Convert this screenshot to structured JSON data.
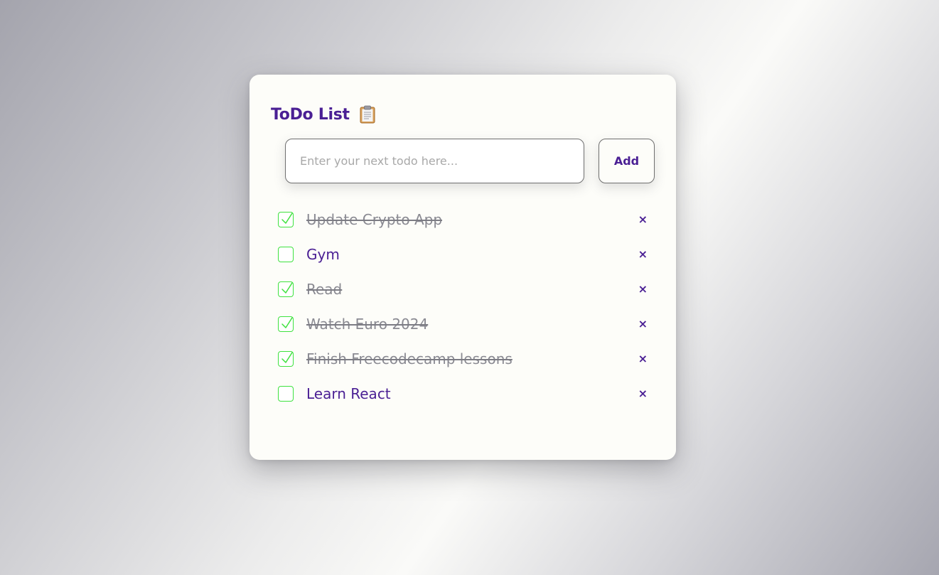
{
  "app": {
    "title": "ToDo List",
    "title_icon": "clipboard-icon"
  },
  "input": {
    "placeholder": "Enter your next todo here...",
    "value": ""
  },
  "add_button": {
    "label": "Add"
  },
  "colors": {
    "accent": "#4a1f94",
    "checkbox_border": "#3fe23f",
    "done_text": "#8a8a92",
    "card_background": "#fdfdf9"
  },
  "todos": [
    {
      "text": "Update Crypto App",
      "done": true,
      "delete_label": "×"
    },
    {
      "text": "Gym",
      "done": false,
      "delete_label": "×"
    },
    {
      "text": "Read",
      "done": true,
      "delete_label": "×"
    },
    {
      "text": "Watch Euro 2024",
      "done": true,
      "delete_label": "×"
    },
    {
      "text": "Finish Freecodecamp lessons",
      "done": true,
      "delete_label": "×"
    },
    {
      "text": "Learn React",
      "done": false,
      "delete_label": "×"
    }
  ]
}
